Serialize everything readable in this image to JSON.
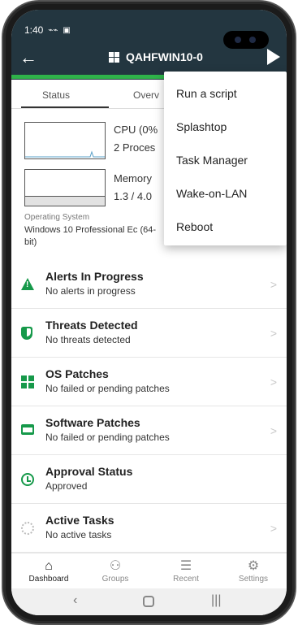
{
  "status_bar": {
    "time": "1:40",
    "icons": [
      "voicemail-icon",
      "image-icon"
    ]
  },
  "header": {
    "title": "QAHFWIN10-0",
    "title_icon": "windows-icon",
    "back_icon": "arrow-left-icon",
    "run_icon": "play-icon",
    "accent_color": "#2fb34a",
    "bg_color": "#233640"
  },
  "tabs": [
    {
      "label": "Status",
      "selected": true
    },
    {
      "label": "Overv",
      "selected": false
    }
  ],
  "overview": {
    "cpu_label": "CPU (0%",
    "cpu_processes": "2 Proces",
    "memory_label": "Memory",
    "memory_value": "1.3 / 4.0",
    "os_caption": "Operating System",
    "os_value": "Windows 10 Professional Ec (64-bit)"
  },
  "menu": {
    "items": [
      "Run a script",
      "Splashtop",
      "Task Manager",
      "Wake-on-LAN",
      "Reboot"
    ]
  },
  "list": [
    {
      "title": "Alerts In Progress",
      "subtitle": "No alerts in progress",
      "icon": "warning-icon"
    },
    {
      "title": "Threats Detected",
      "subtitle": "No threats detected",
      "icon": "shield-icon"
    },
    {
      "title": "OS Patches",
      "subtitle": "No failed or pending patches",
      "icon": "windows-icon"
    },
    {
      "title": "Software Patches",
      "subtitle": "No failed or pending patches",
      "icon": "software-icon"
    },
    {
      "title": "Approval Status",
      "subtitle": "Approved",
      "icon": "approval-icon"
    },
    {
      "title": "Active Tasks",
      "subtitle": "No active tasks",
      "icon": "spinner-icon"
    }
  ],
  "bottom_nav": [
    {
      "label": "Dashboard",
      "icon": "home-icon",
      "active": true
    },
    {
      "label": "Groups",
      "icon": "groups-icon",
      "active": false
    },
    {
      "label": "Recent",
      "icon": "list-icon",
      "active": false
    },
    {
      "label": "Settings",
      "icon": "gear-icon",
      "active": false
    }
  ],
  "colors": {
    "primary_green": "#16994a",
    "menu_text": "#222222"
  }
}
